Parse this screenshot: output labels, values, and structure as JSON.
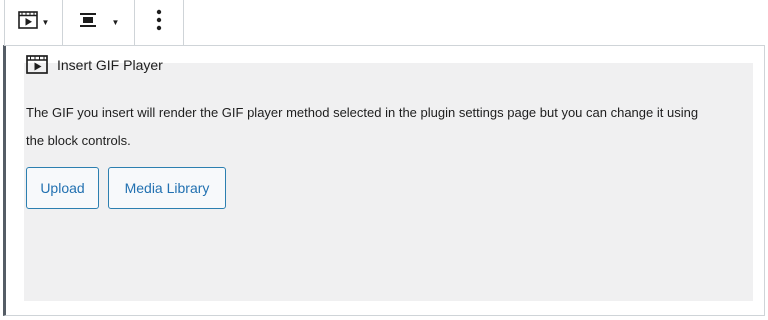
{
  "toolbar": {
    "block_type_icon": "video-player-icon",
    "align_icon": "align-center-icon",
    "more_icon": "more-vertical-icon"
  },
  "placeholder": {
    "icon": "video-player-icon",
    "label": "Insert GIF Player",
    "instructions": "The GIF you insert will render the GIF player method selected in the plugin settings page but you can change it using the block controls.",
    "upload_label": "Upload",
    "media_library_label": "Media Library"
  },
  "colors": {
    "accent": "#2271b1",
    "placeholder_bg": "#f0f0f1",
    "border": "#cfd4d8",
    "text": "#1e1e1e"
  }
}
